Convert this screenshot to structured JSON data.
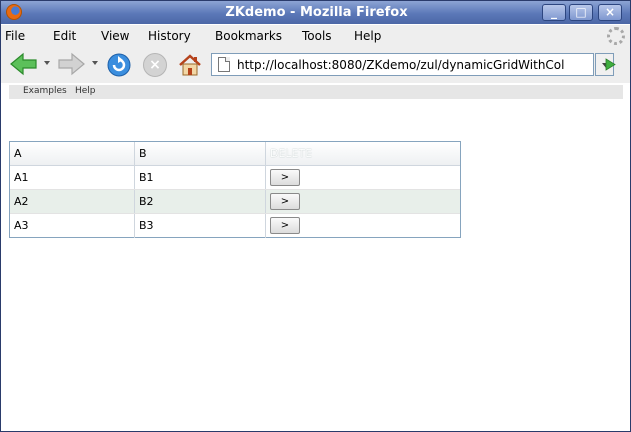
{
  "window": {
    "title": "ZKdemo - Mozilla Firefox"
  },
  "menubar": {
    "items": [
      {
        "label": "File"
      },
      {
        "label": "Edit"
      },
      {
        "label": "View"
      },
      {
        "label": "History"
      },
      {
        "label": "Bookmarks"
      },
      {
        "label": "Tools"
      },
      {
        "label": "Help"
      }
    ]
  },
  "navbar": {
    "url": "http://localhost:8080/ZKdemo/zul/dynamicGridWithCol"
  },
  "bookmarks": {
    "items": [
      {
        "label": "Examples"
      },
      {
        "label": "Help"
      }
    ]
  },
  "grid": {
    "headers": [
      "A",
      "B",
      "DELETE"
    ],
    "rows": [
      {
        "a": "A1",
        "b": "B1",
        "button": ">"
      },
      {
        "a": "A2",
        "b": "B2",
        "button": ">"
      },
      {
        "a": "A3",
        "b": "B3",
        "button": ">"
      }
    ]
  },
  "colors": {
    "titlebar": "#5b78b8",
    "grid_border": "#86a4be",
    "alt_row": "#e8efea",
    "back_arrow": "#3fae3f",
    "reload": "#2d7fd3"
  },
  "icons": [
    "firefox-logo-icon",
    "back-arrow-icon",
    "forward-arrow-icon",
    "reload-icon",
    "stop-icon",
    "home-icon",
    "page-icon",
    "go-icon",
    "throbber-icon"
  ]
}
